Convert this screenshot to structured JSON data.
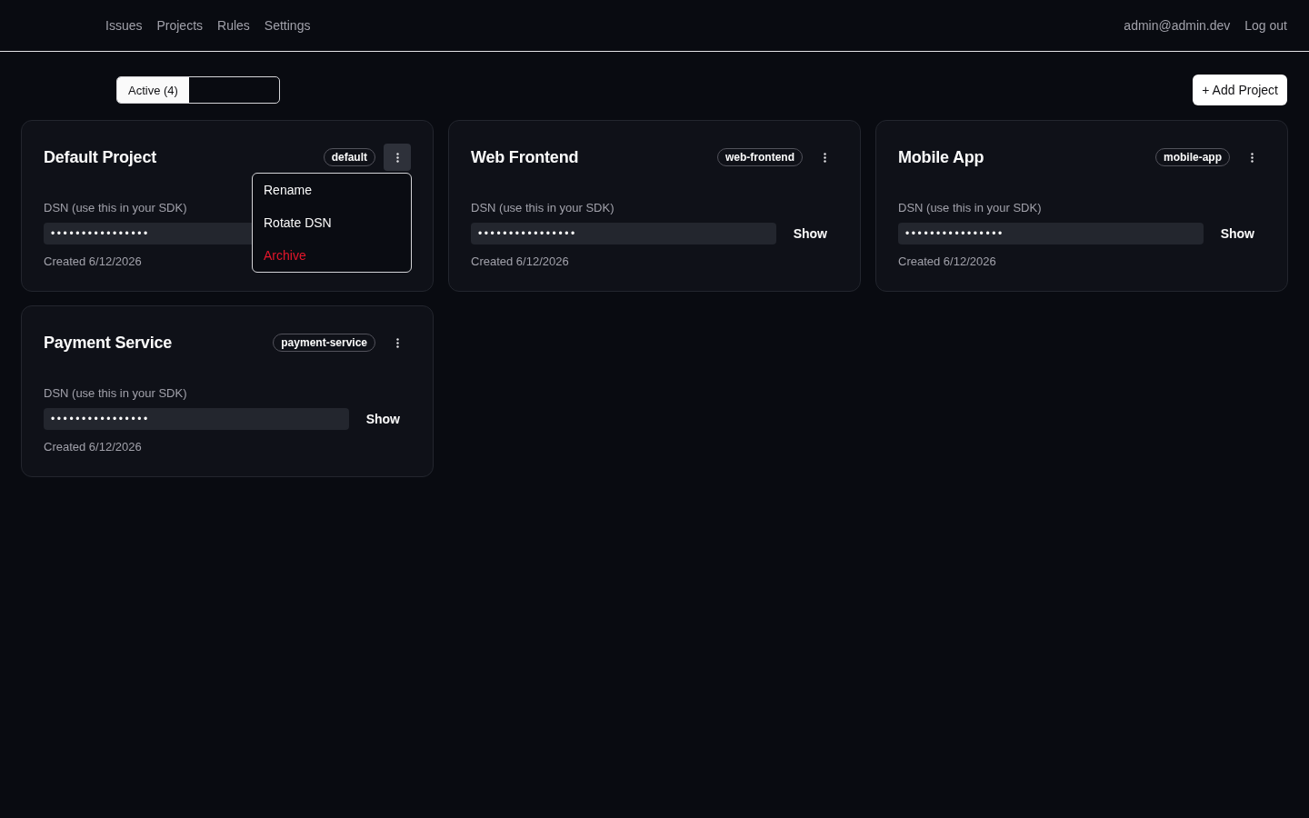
{
  "nav": {
    "links": [
      {
        "label": "Issues"
      },
      {
        "label": "Projects"
      },
      {
        "label": "Rules"
      },
      {
        "label": "Settings"
      }
    ],
    "user_email": "admin@admin.dev",
    "logout": "Log out"
  },
  "filter_tabs": [
    {
      "label": "Active (4)",
      "selected": true
    }
  ],
  "add_button": "+ Add Project",
  "projects": [
    {
      "name": "Default Project",
      "slug": "default",
      "menu_open": true,
      "menu": [
        {
          "label": "Rename",
          "kind": "normal"
        },
        {
          "label": "Rotate DSN",
          "kind": "normal"
        },
        {
          "label": "Archive",
          "kind": "danger"
        }
      ],
      "dsn_label": "DSN (use this in your SDK)",
      "dsn_masked": "••••••••••••••••",
      "created": "Created 6/12/2026"
    },
    {
      "name": "Web Frontend",
      "slug": "web-frontend",
      "menu_open": false,
      "dsn_label": "DSN (use this in your SDK)",
      "dsn_masked": "••••••••••••••••",
      "show_label": "Show",
      "created": "Created 6/12/2026"
    },
    {
      "name": "Mobile App",
      "slug": "mobile-app",
      "menu_open": false,
      "dsn_label": "DSN (use this in your SDK)",
      "dsn_masked": "••••••••••••••••",
      "show_label": "Show",
      "created": "Created 6/12/2026"
    },
    {
      "name": "Payment Service",
      "slug": "payment-service",
      "menu_open": false,
      "dsn_label": "DSN (use this in your SDK)",
      "dsn_masked": "••••••••••••••••",
      "show_label": "Show",
      "created": "Created 6/12/2026"
    }
  ]
}
